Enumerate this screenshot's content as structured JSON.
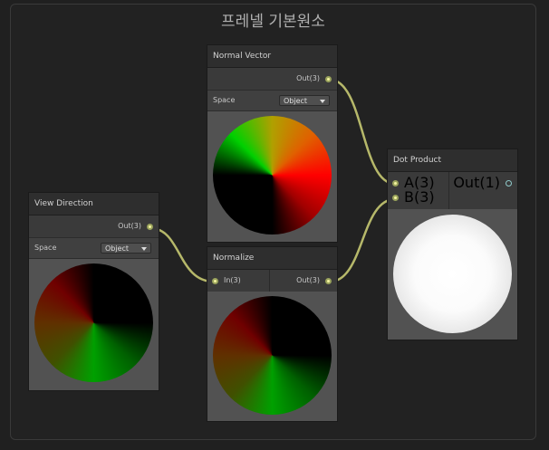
{
  "group": {
    "title": "프레넬 기본원소"
  },
  "nodes": {
    "normal_vector": {
      "title": "Normal Vector",
      "out": "Out(3)",
      "space_label": "Space",
      "space_value": "Object"
    },
    "view_direction": {
      "title": "View Direction",
      "out": "Out(3)",
      "space_label": "Space",
      "space_value": "Object"
    },
    "normalize": {
      "title": "Normalize",
      "in": "In(3)",
      "out": "Out(3)"
    },
    "dot_product": {
      "title": "Dot Product",
      "in_a": "A(3)",
      "in_b": "B(3)",
      "out": "Out(1)"
    }
  },
  "colors": {
    "wire": "#b6b86a",
    "port_vec3": "#f4f4a0",
    "port_vec1": "#8fc9c9"
  }
}
